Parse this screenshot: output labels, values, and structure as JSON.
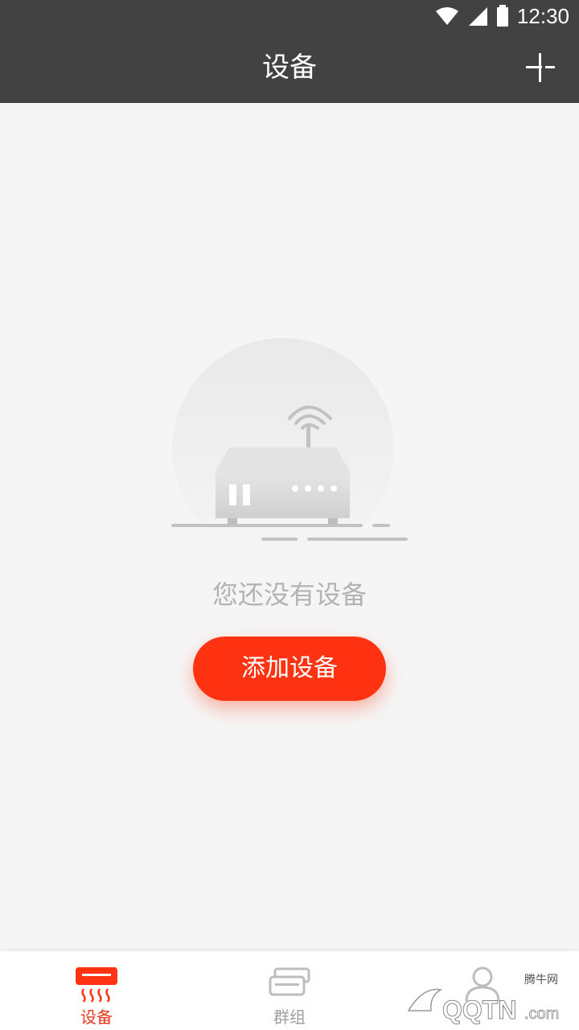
{
  "status": {
    "time": "12:30"
  },
  "header": {
    "title": "设备"
  },
  "empty": {
    "message": "您还没有设备",
    "button": "添加设备"
  },
  "tabs": [
    {
      "label": "设备",
      "icon": "device-icon",
      "active": true
    },
    {
      "label": "群组",
      "icon": "group-icon",
      "active": false
    },
    {
      "label": "",
      "icon": "profile-icon",
      "active": false
    }
  ],
  "watermark": {
    "brand": "QQTN",
    "suffix": ".com",
    "label": "腾牛网"
  },
  "colors": {
    "accent": "#ff3312",
    "appbar": "#424242",
    "background": "#f5f5f5"
  }
}
